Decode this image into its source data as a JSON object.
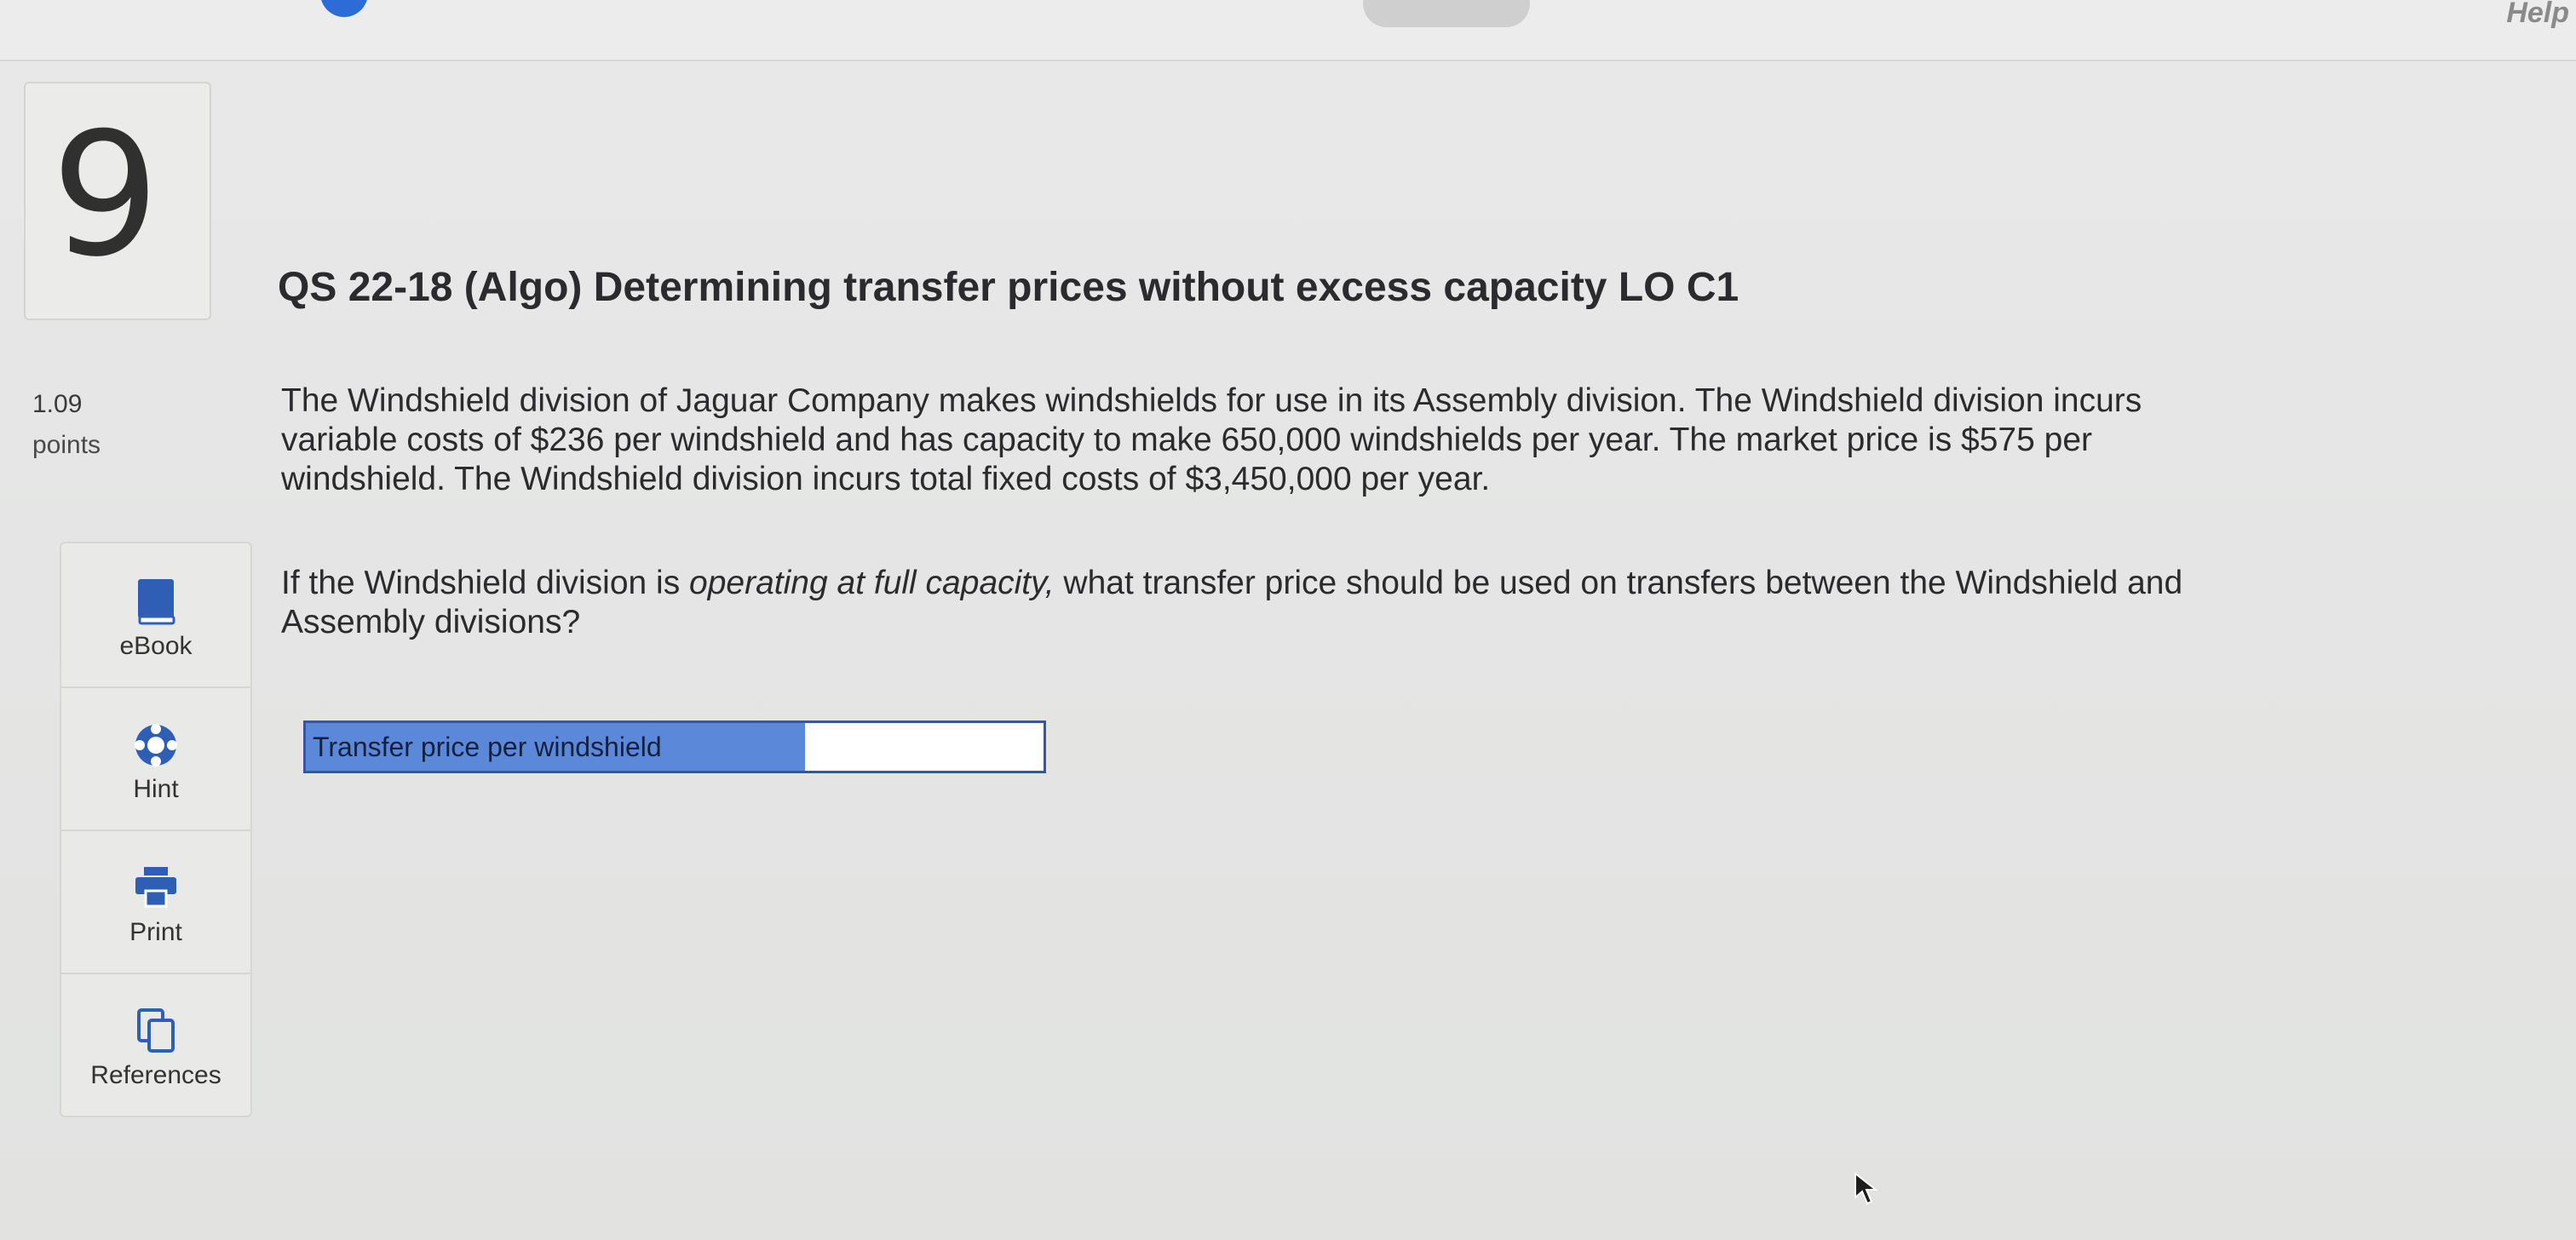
{
  "header": {
    "help_label": "Help"
  },
  "question": {
    "number": "9",
    "points_value": "1.09",
    "points_label": "points",
    "title": "QS 22-18 (Algo) Determining transfer prices without excess capacity LO C1",
    "paragraph1_lines": [
      "The Windshield division of Jaguar Company makes windshields for use in its Assembly division. The Windshield division incurs",
      "variable costs of $236 per windshield and has capacity to make 650,000 windshields per year. The market price is $575 per",
      "windshield. The Windshield division incurs total fixed costs of $3,450,000 per year."
    ],
    "paragraph2": {
      "line1_before": "If the Windshield division is ",
      "line1_emphasis": "operating at full capacity,",
      "line1_after": " what transfer price should be used on transfers between the Windshield and",
      "line2": "Assembly divisions?"
    },
    "answer": {
      "label": "Transfer price per windshield",
      "value": ""
    }
  },
  "tools": [
    {
      "label": "eBook",
      "icon": "book-icon"
    },
    {
      "label": "Hint",
      "icon": "lifebuoy-icon"
    },
    {
      "label": "Print",
      "icon": "printer-icon"
    },
    {
      "label": "References",
      "icon": "copy-pages-icon"
    }
  ],
  "colors": {
    "accent_blue": "#5b88d8",
    "border_blue": "#34589b",
    "icon_blue": "#2f5fb4",
    "text_dark": "#2b2b2d"
  }
}
